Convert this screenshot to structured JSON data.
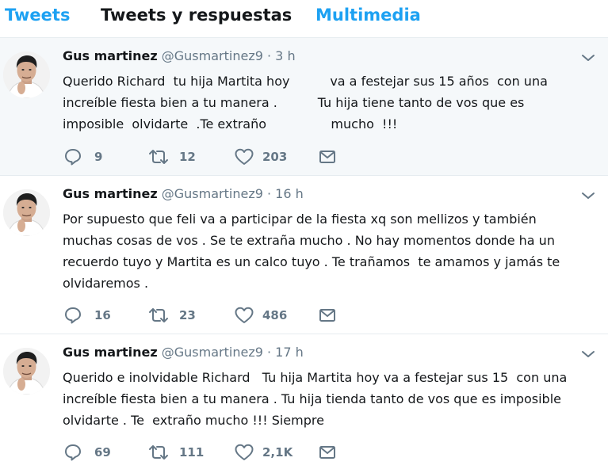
{
  "tabs": [
    "Tweets",
    "Tweets y respuestas",
    "Multimedia"
  ],
  "tweets": [
    {
      "name": "Gus martinez",
      "handle": "@Gusmartinez9",
      "separator": "·",
      "time": "3 h",
      "lines": [
        "Querido Richard  tu hija Martita hoy          va a festejar sus 15 años  con una",
        "increíble fiesta bien a tu manera .          Tu hija tiene tanto de vos que es",
        "imposible  olvidarte  .Te extraño                mucho  !!!"
      ],
      "replies": "9",
      "retweets": "12",
      "likes": "203"
    },
    {
      "name": "Gus martinez",
      "handle": "@Gusmartinez9",
      "separator": "·",
      "time": "16 h",
      "lines": [
        "Por supuesto que feli va a participar de la fiesta xq son mellizos y también",
        "muchas cosas de vos . Se te extraña mucho . No hay momentos donde ha un",
        "recuerdo tuyo y Martita es un calco tuyo . Te trañamos  te amamos y jamás te",
        "olvidaremos ."
      ],
      "replies": "16",
      "retweets": "23",
      "likes": "486"
    },
    {
      "name": "Gus martinez",
      "handle": "@Gusmartinez9",
      "separator": "·",
      "time": "17 h",
      "lines": [
        "Querido e inolvidable Richard   Tu hija Martita hoy va a festejar sus 15  con una",
        "increíble fiesta bien a tu manera . Tu hija tienda tanto de vos que es imposible",
        "olvidarte . Te  extraño mucho !!! Siempre"
      ],
      "replies": "69",
      "retweets": "111",
      "likes": "2,1K"
    }
  ]
}
